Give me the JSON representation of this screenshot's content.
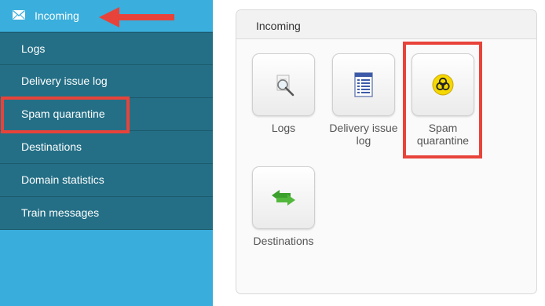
{
  "sidebar": {
    "header": {
      "label": "Incoming",
      "icon": "envelope-icon"
    },
    "items": [
      {
        "label": "Logs"
      },
      {
        "label": "Delivery issue log"
      },
      {
        "label": "Spam quarantine"
      },
      {
        "label": "Destinations"
      },
      {
        "label": "Domain statistics"
      },
      {
        "label": "Train messages"
      }
    ]
  },
  "panel": {
    "title": "Incoming",
    "tiles": [
      {
        "label": "Logs",
        "icon": "magnifier-icon"
      },
      {
        "label": "Delivery issue log",
        "icon": "document-list-icon"
      },
      {
        "label": "Spam quarantine",
        "icon": "biohazard-icon"
      },
      {
        "label": "Destinations",
        "icon": "two-way-arrows-icon"
      }
    ]
  },
  "colors": {
    "sidebar_bg": "#39aedc",
    "sidebar_item_bg": "#246f86",
    "highlight": "#e8433a"
  }
}
